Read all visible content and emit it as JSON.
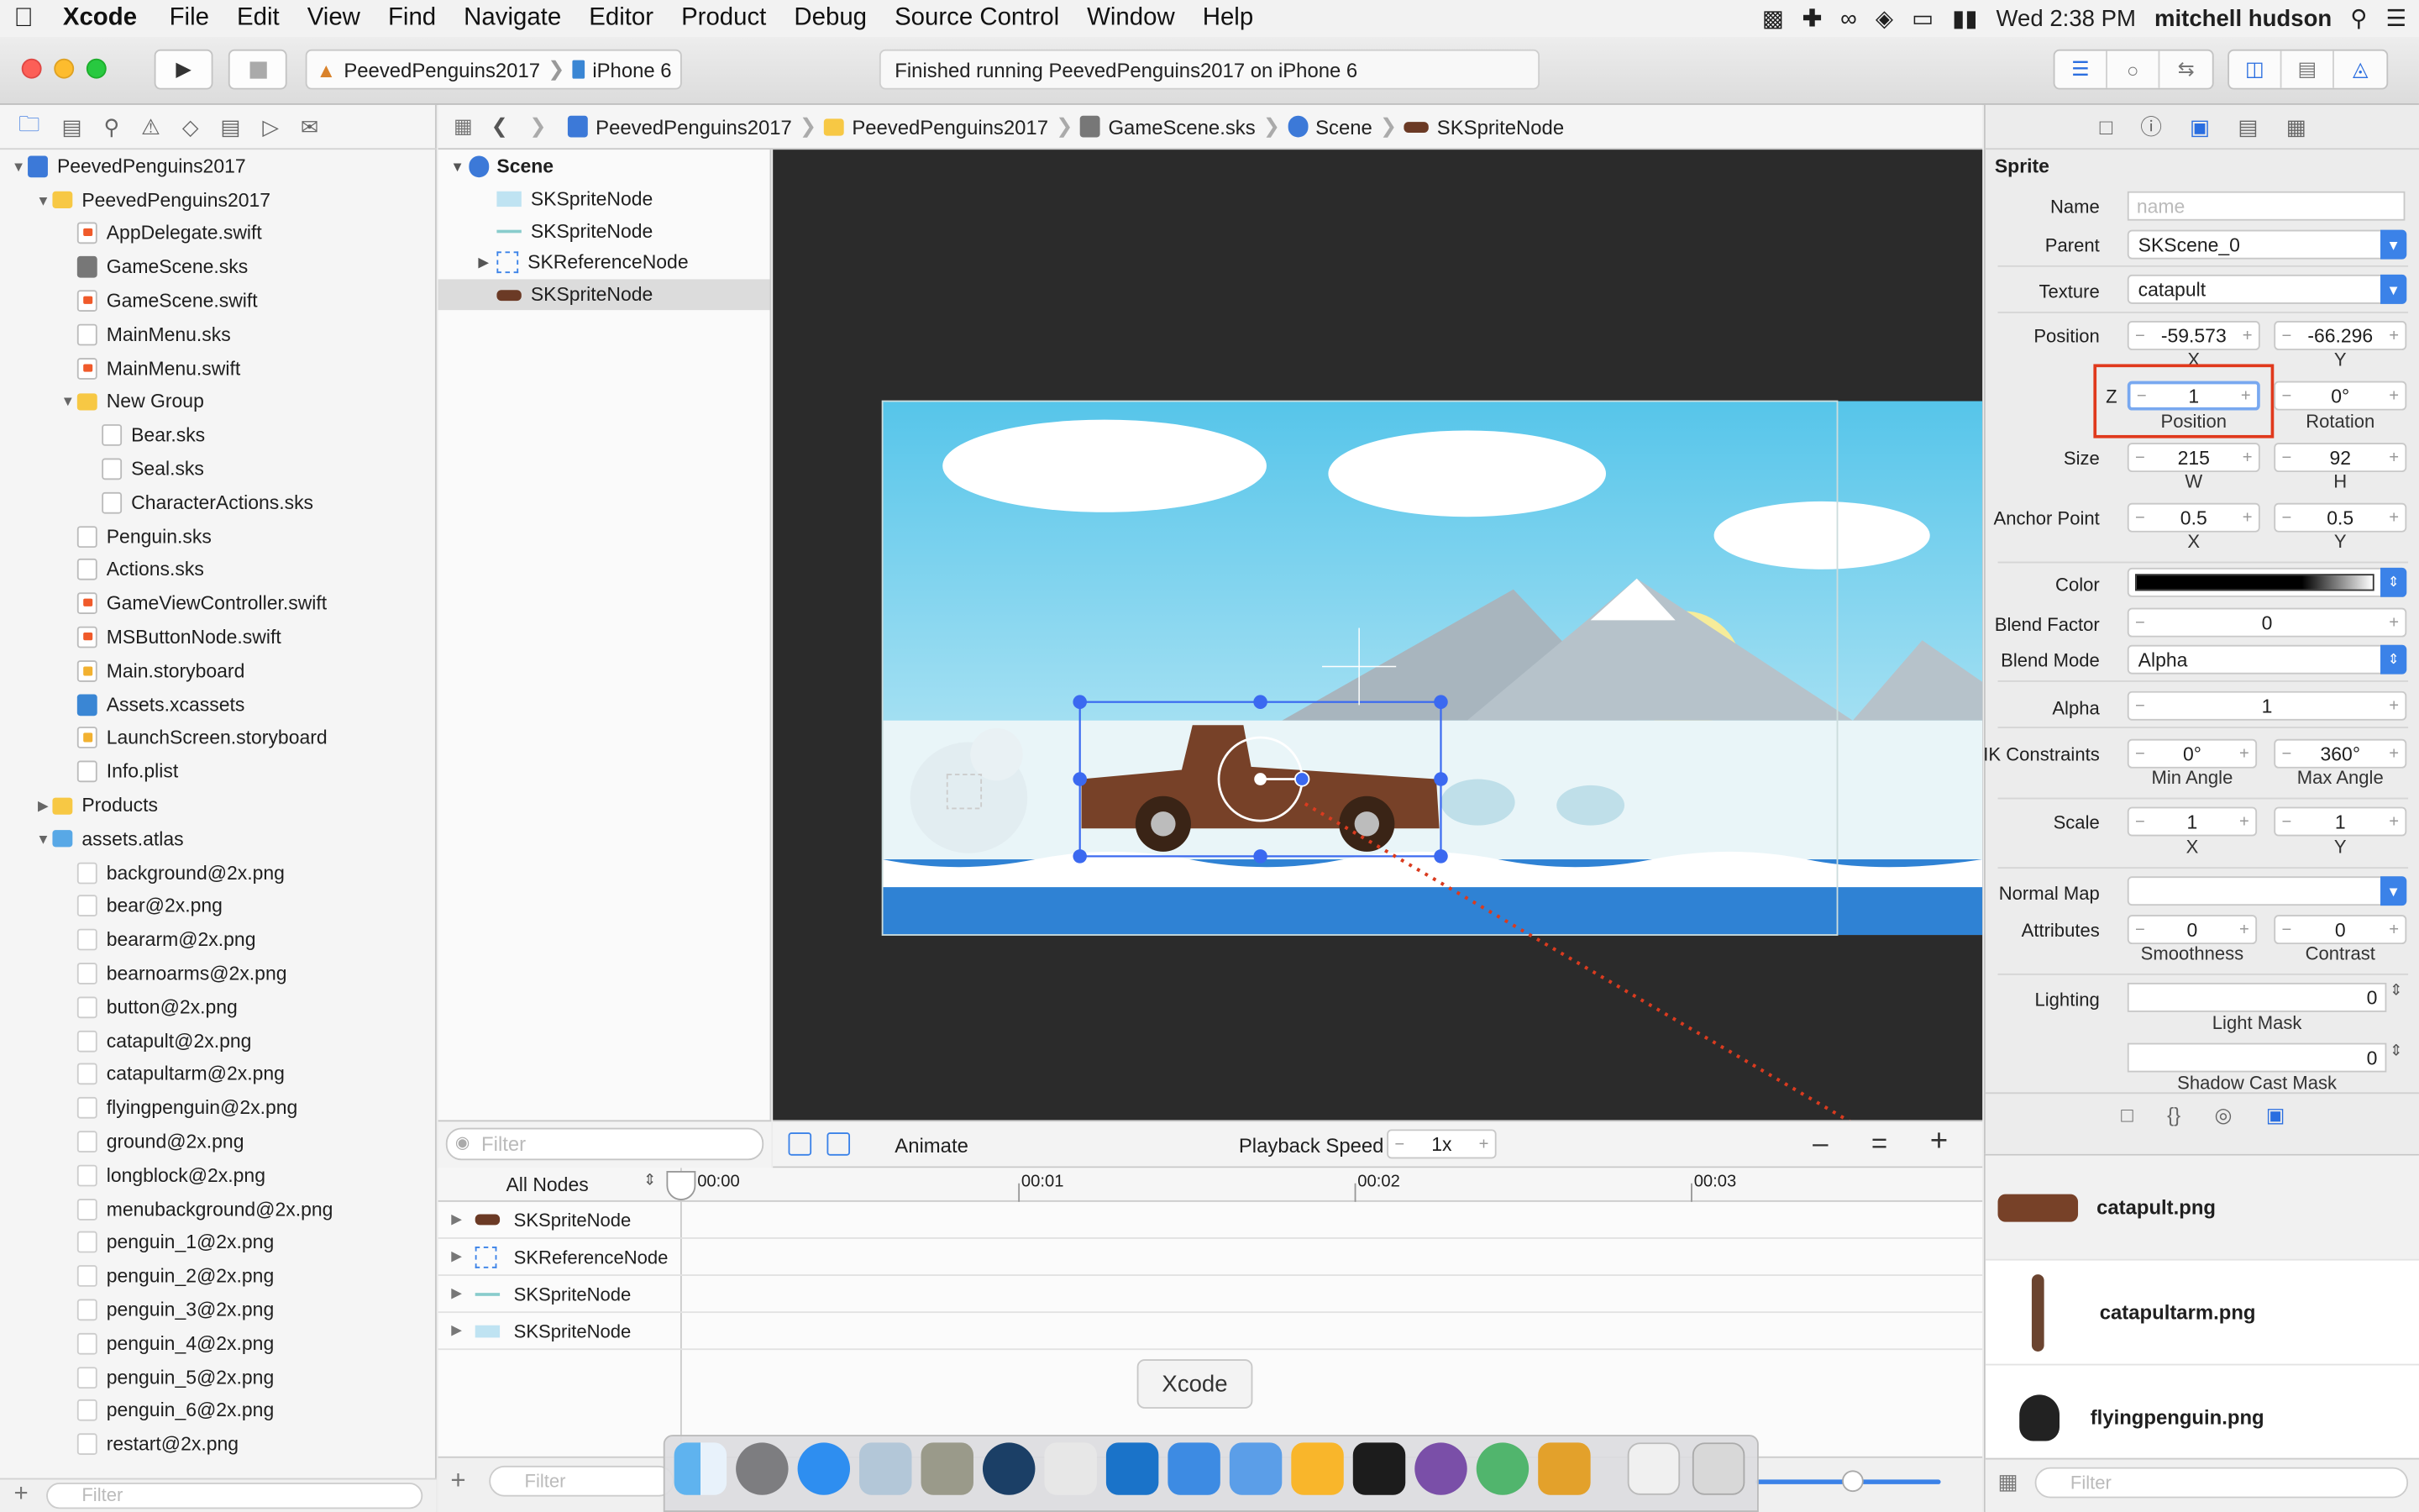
{
  "menubar": {
    "app_name": "Xcode",
    "items": [
      "File",
      "Edit",
      "View",
      "Find",
      "Navigate",
      "Editor",
      "Product",
      "Debug",
      "Source Control",
      "Window",
      "Help"
    ],
    "clock": "Wed 2:38 PM",
    "user": "mitchell hudson"
  },
  "toolbar": {
    "scheme": "PeevedPenguins2017",
    "device": "iPhone 6",
    "status": "Finished running PeevedPenguins2017 on iPhone 6"
  },
  "navigator": {
    "filter_placeholder": "Filter",
    "tree": [
      {
        "label": "PeevedPenguins2017",
        "icon": "project-icon",
        "indent": 0,
        "disclosure": "open"
      },
      {
        "label": "PeevedPenguins2017",
        "icon": "folder-icon",
        "indent": 1,
        "disclosure": "open"
      },
      {
        "label": "AppDelegate.swift",
        "icon": "swift-file-icon",
        "indent": 2
      },
      {
        "label": "GameScene.sks",
        "icon": "sks-file-icon",
        "indent": 2
      },
      {
        "label": "GameScene.swift",
        "icon": "swift-file-icon",
        "indent": 2
      },
      {
        "label": "MainMenu.sks",
        "icon": "sks-file-icon",
        "indent": 2
      },
      {
        "label": "MainMenu.swift",
        "icon": "swift-file-icon",
        "indent": 2
      },
      {
        "label": "New Group",
        "icon": "folder-icon",
        "indent": 2,
        "disclosure": "open"
      },
      {
        "label": "Bear.sks",
        "icon": "sks-file-icon",
        "indent": 3
      },
      {
        "label": "Seal.sks",
        "icon": "sks-file-icon",
        "indent": 3
      },
      {
        "label": "CharacterActions.sks",
        "icon": "sks-file-icon",
        "indent": 3
      },
      {
        "label": "Penguin.sks",
        "icon": "sks-file-icon",
        "indent": 2
      },
      {
        "label": "Actions.sks",
        "icon": "sks-file-icon",
        "indent": 2
      },
      {
        "label": "GameViewController.swift",
        "icon": "swift-file-icon",
        "indent": 2
      },
      {
        "label": "MSButtonNode.swift",
        "icon": "swift-file-icon",
        "indent": 2
      },
      {
        "label": "Main.storyboard",
        "icon": "storyboard-icon",
        "indent": 2
      },
      {
        "label": "Assets.xcassets",
        "icon": "xcassets-icon",
        "indent": 2
      },
      {
        "label": "LaunchScreen.storyboard",
        "icon": "storyboard-icon",
        "indent": 2
      },
      {
        "label": "Info.plist",
        "icon": "plist-icon",
        "indent": 2
      },
      {
        "label": "Products",
        "icon": "folder-icon",
        "indent": 1,
        "disclosure": "closed"
      },
      {
        "label": "assets.atlas",
        "icon": "blue-folder-icon",
        "indent": 1,
        "disclosure": "open"
      },
      {
        "label": "background@2x.png",
        "icon": "png-icon",
        "indent": 2
      },
      {
        "label": "bear@2x.png",
        "icon": "png-icon",
        "indent": 2
      },
      {
        "label": "beararm@2x.png",
        "icon": "png-icon",
        "indent": 2
      },
      {
        "label": "bearnoarms@2x.png",
        "icon": "png-icon",
        "indent": 2
      },
      {
        "label": "button@2x.png",
        "icon": "png-icon",
        "indent": 2
      },
      {
        "label": "catapult@2x.png",
        "icon": "png-icon",
        "indent": 2
      },
      {
        "label": "catapultarm@2x.png",
        "icon": "png-icon",
        "indent": 2
      },
      {
        "label": "flyingpenguin@2x.png",
        "icon": "png-icon",
        "indent": 2
      },
      {
        "label": "ground@2x.png",
        "icon": "png-icon",
        "indent": 2
      },
      {
        "label": "longblock@2x.png",
        "icon": "png-icon",
        "indent": 2
      },
      {
        "label": "menubackground@2x.png",
        "icon": "png-icon",
        "indent": 2
      },
      {
        "label": "penguin_1@2x.png",
        "icon": "png-icon",
        "indent": 2
      },
      {
        "label": "penguin_2@2x.png",
        "icon": "png-icon",
        "indent": 2
      },
      {
        "label": "penguin_3@2x.png",
        "icon": "png-icon",
        "indent": 2
      },
      {
        "label": "penguin_4@2x.png",
        "icon": "png-icon",
        "indent": 2
      },
      {
        "label": "penguin_5@2x.png",
        "icon": "png-icon",
        "indent": 2
      },
      {
        "label": "penguin_6@2x.png",
        "icon": "png-icon",
        "indent": 2
      },
      {
        "label": "restart@2x.png",
        "icon": "png-icon",
        "indent": 2
      }
    ]
  },
  "jumpbar": [
    "PeevedPenguins2017",
    "PeevedPenguins2017",
    "GameScene.sks",
    "Scene",
    "SKSpriteNode"
  ],
  "outline": {
    "root": "Scene",
    "items": [
      "SKSpriteNode",
      "SKSpriteNode",
      "SKReferenceNode",
      "SKSpriteNode"
    ],
    "filter_placeholder": "Filter"
  },
  "animate_bar": {
    "animate": "Animate",
    "playback_label": "Playback Speed",
    "playback_value": "1x"
  },
  "timeline": {
    "filter": "All Nodes",
    "ticks": [
      "00:00",
      "00:01",
      "00:02",
      "00:03"
    ],
    "rows": [
      "SKSpriteNode",
      "SKReferenceNode",
      "SKSpriteNode",
      "SKSpriteNode"
    ]
  },
  "inspector": {
    "section": "Sprite",
    "name_label": "Name",
    "name_placeholder": "name",
    "parent_label": "Parent",
    "parent_value": "SKScene_0",
    "texture_label": "Texture",
    "texture_value": "catapult",
    "position_label": "Position",
    "position_x": "-59.573",
    "position_y": "-66.296",
    "x": "X",
    "y": "Y",
    "z_label": "Z",
    "z_value": "1",
    "z_sub": "Position",
    "rotation_value": "0°",
    "rotation_sub": "Rotation",
    "size_label": "Size",
    "size_w": "215",
    "size_h": "92",
    "w": "W",
    "h": "H",
    "anchor_label": "Anchor Point",
    "anchor_x": "0.5",
    "anchor_y": "0.5",
    "color_label": "Color",
    "blend_factor_label": "Blend Factor",
    "blend_factor": "0",
    "blend_mode_label": "Blend Mode",
    "blend_mode": "Alpha",
    "alpha_label": "Alpha",
    "alpha": "1",
    "ik_label": "IK Constraints",
    "ik_min": "0°",
    "ik_max": "360°",
    "min_angle": "Min Angle",
    "max_angle": "Max Angle",
    "scale_label": "Scale",
    "scale_x": "1",
    "scale_y": "1",
    "normal_map_label": "Normal Map",
    "attributes_label": "Attributes",
    "smoothness": "0",
    "contrast": "0",
    "smoothness_sub": "Smoothness",
    "contrast_sub": "Contrast",
    "lighting_label": "Lighting",
    "light_mask": "0",
    "light_mask_sub": "Light Mask",
    "shadow_cast_mask": "0",
    "shadow_cast_sub": "Shadow Cast Mask"
  },
  "library": {
    "items": [
      "catapult.png",
      "catapultarm.png",
      "flyingpenguin.png"
    ],
    "filter_placeholder": "Filter"
  },
  "dock": {
    "tooltip": "Xcode"
  },
  "colors": {
    "accent": "#3b82e8",
    "highlight": "#e0391c",
    "canvas": "#2b2b2b"
  }
}
